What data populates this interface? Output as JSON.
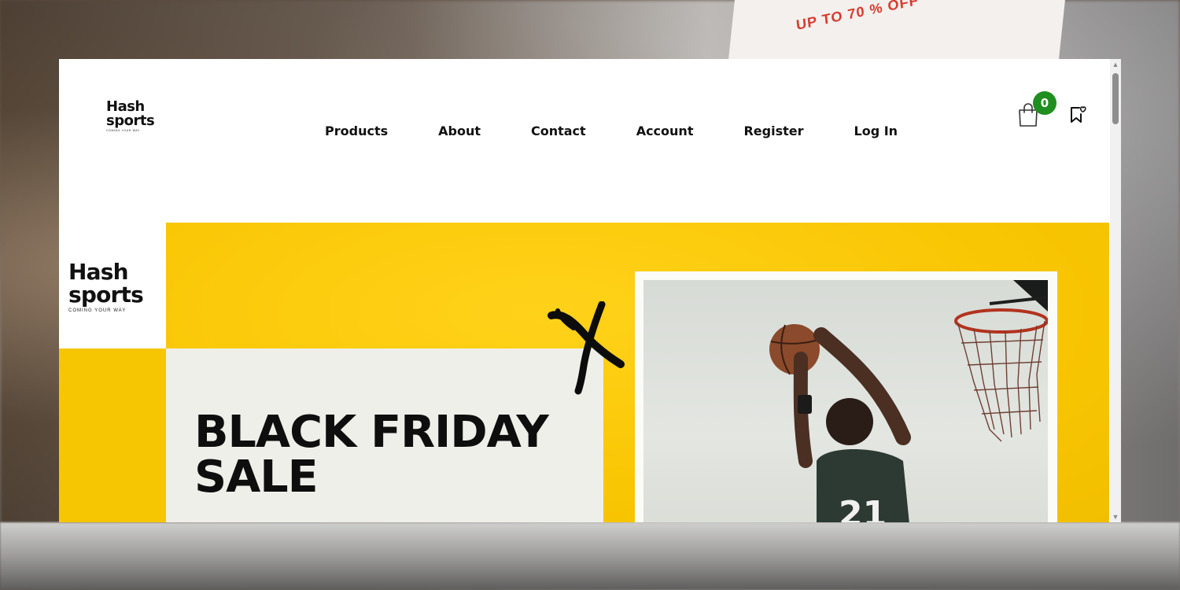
{
  "background": {
    "laptop_text": "UP TO 70 % OFF"
  },
  "site": {
    "logo_line1": "Hash",
    "logo_line2": "sports",
    "logo_tagline": "COMING YOUR WAY"
  },
  "nav": {
    "items": [
      {
        "label": "Products"
      },
      {
        "label": "About"
      },
      {
        "label": "Contact"
      },
      {
        "label": "Account"
      },
      {
        "label": "Register"
      },
      {
        "label": "Log In"
      }
    ]
  },
  "cart": {
    "count": "0",
    "icon": "shopping-bag-icon",
    "badge_color": "#1f8f1f"
  },
  "wishlist": {
    "icon": "bookmark-heart-icon"
  },
  "hero": {
    "logo_line1": "Hash",
    "logo_line2": "sports",
    "logo_tagline": "COMING YOUR WAY",
    "title_line1": "BLACK FRIDAY",
    "title_line2": "SALE",
    "accent_color": "#f9c603",
    "jersey_text": "21"
  }
}
